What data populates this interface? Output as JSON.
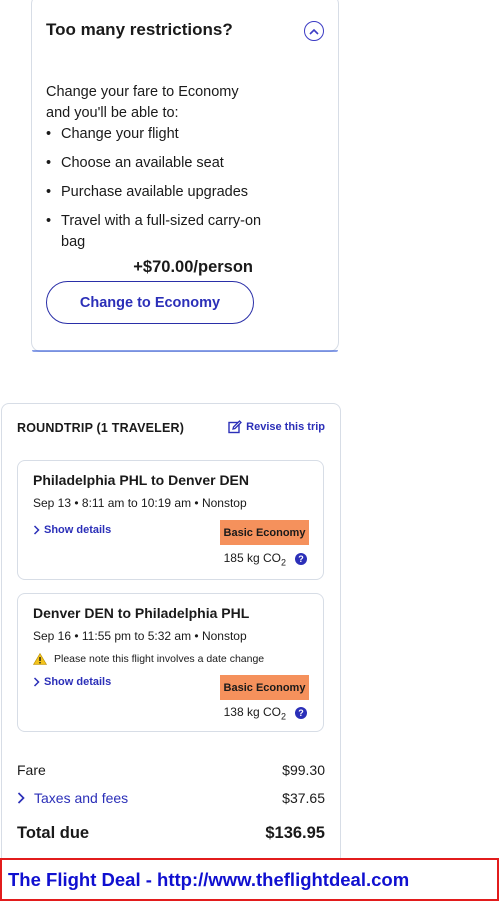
{
  "restrictions": {
    "title": "Too many restrictions?",
    "intro": "Change your fare to Economy and you'll be able to:",
    "benefits": [
      "Change your flight",
      "Choose an available seat",
      "Purchase available upgrades",
      "Travel with a full-sized carry-on bag"
    ],
    "price": "+$70.00/person",
    "button_label": "Change to Economy",
    "collapse_icon": "chevron-up-circle-icon"
  },
  "trip": {
    "heading": "ROUNDTRIP (1 TRAVELER)",
    "revise_label": "Revise this trip",
    "flights": [
      {
        "route": "Philadelphia PHL to Denver DEN",
        "schedule": "Sep 13 • 8:11 am to 10:19 am • Nonstop",
        "details_label": "Show details",
        "fare_class": "Basic Economy",
        "co2_value": "185 kg CO",
        "co2_sub": "2",
        "help": "?"
      },
      {
        "route": "Denver DEN to Philadelphia PHL",
        "schedule": "Sep 16 • 11:55 pm to 5:32 am • Nonstop",
        "notice": "Please note this flight involves a date change",
        "details_label": "Show details",
        "fare_class": "Basic Economy",
        "co2_value": "138 kg CO",
        "co2_sub": "2",
        "help": "?"
      }
    ],
    "summary": {
      "fare_label": "Fare",
      "fare_value": "$99.30",
      "taxes_label": "Taxes and fees",
      "taxes_value": "$37.65",
      "total_label": "Total due",
      "total_value": "$136.95"
    }
  },
  "banner": {
    "text": "The Flight Deal - http://www.theflightdeal.com"
  },
  "colors": {
    "accent": "#2b2fb8",
    "badge": "#f5915c",
    "warning": "#f2c21b",
    "banner_border": "#e21c1c",
    "banner_text": "#1010d0"
  }
}
